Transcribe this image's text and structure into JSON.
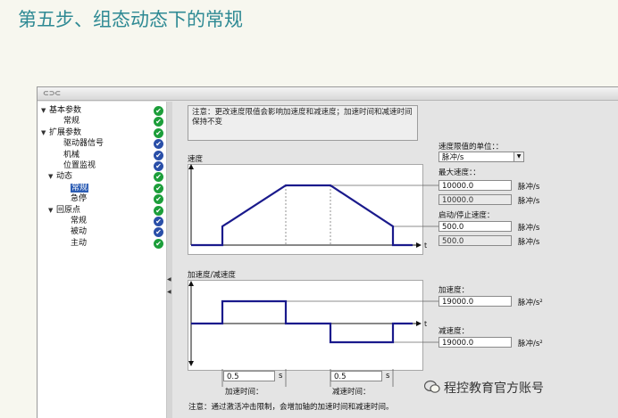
{
  "slide": {
    "title": "第五步、组态动态下的常规"
  },
  "window": {
    "icon_text": "⊂⊃⊂"
  },
  "tree": {
    "items": [
      {
        "label": "基本参数",
        "toggle": "▼",
        "status": "✔",
        "color": "green"
      },
      {
        "label": "常规",
        "toggle": "",
        "status": "✔",
        "color": "green"
      },
      {
        "label": "扩展参数",
        "toggle": "▼",
        "status": "✔",
        "color": "green"
      },
      {
        "label": "驱动器信号",
        "toggle": "",
        "status": "✔",
        "color": "blue"
      },
      {
        "label": "机械",
        "toggle": "",
        "status": "✔",
        "color": "blue"
      },
      {
        "label": "位置监视",
        "toggle": "",
        "status": "✔",
        "color": "blue"
      },
      {
        "label": "动态",
        "toggle": "▼",
        "status": "✔",
        "color": "green"
      },
      {
        "label": "常规",
        "toggle": "",
        "status": "✔",
        "color": "green",
        "selected": true
      },
      {
        "label": "急停",
        "toggle": "",
        "status": "✔",
        "color": "green"
      },
      {
        "label": "回原点",
        "toggle": "▼",
        "status": "✔",
        "color": "green"
      },
      {
        "label": "常规",
        "toggle": "",
        "status": "✔",
        "color": "blue"
      },
      {
        "label": "被动",
        "toggle": "",
        "status": "✔",
        "color": "blue"
      },
      {
        "label": "主动",
        "toggle": "",
        "status": "✔",
        "color": "green"
      }
    ]
  },
  "note": "注意：更改速度限值会影响加速度和减速度；加速时间和减速时间保持不变",
  "velocity_graph": {
    "label": "速度",
    "axis_t": "t"
  },
  "accel_graph": {
    "label": "加速度/减速度",
    "axis_t": "t"
  },
  "speed_limit_unit": {
    "label": "速度限值的单位：：",
    "value": "脉冲/s"
  },
  "max_speed": {
    "label": "最大速度：：",
    "value": "10000.0",
    "value_ro": "10000.0",
    "unit": "脉冲/s"
  },
  "start_stop_speed": {
    "label": "启动/停止速度：",
    "value": "500.0",
    "value_ro": "500.0",
    "unit": "脉冲/s"
  },
  "acceleration": {
    "label": "加速度：",
    "value": "19000.0",
    "unit": "脉冲/s²"
  },
  "deceleration": {
    "label": "减速度：",
    "value": "19000.0",
    "unit": "脉冲/s²"
  },
  "accel_time": {
    "label": "加速时间：",
    "value": "0.5",
    "unit": "s"
  },
  "decel_time": {
    "label": "减速时间：",
    "value": "0.5",
    "unit": "s"
  },
  "footer_note": "注意：通过激活冲击限制，会增加轴的加速时间和减速时间。",
  "watermark": {
    "text": "程控教育官方账号"
  },
  "colors": {
    "curve": "#1a1a8c",
    "accent": "#2c5db4",
    "ok_green": "#1c9e3a",
    "ok_blue": "#2a4fa8"
  }
}
